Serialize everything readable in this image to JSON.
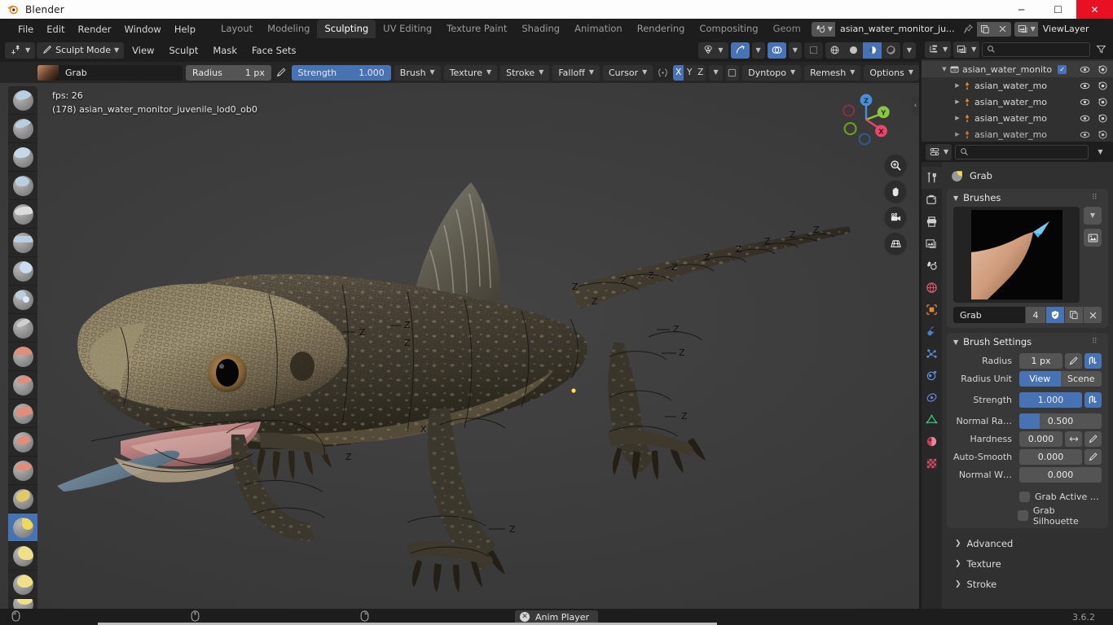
{
  "window": {
    "title": "Blender",
    "app_icon": "blender-logo-icon",
    "minimize": "─",
    "maximize": "☐",
    "close": "✕"
  },
  "topbar": {
    "menus": [
      "File",
      "Edit",
      "Render",
      "Window",
      "Help"
    ],
    "workspaces": [
      {
        "label": "Layout",
        "active": false
      },
      {
        "label": "Modeling",
        "active": false
      },
      {
        "label": "Sculpting",
        "active": true
      },
      {
        "label": "UV Editing",
        "active": false
      },
      {
        "label": "Texture Paint",
        "active": false
      },
      {
        "label": "Shading",
        "active": false
      },
      {
        "label": "Animation",
        "active": false
      },
      {
        "label": "Rendering",
        "active": false
      },
      {
        "label": "Compositing",
        "active": false
      },
      {
        "label": "Geom",
        "active": false
      }
    ],
    "scene_name": "asian_water_monitor_ju...",
    "viewlayer_name": "ViewLayer"
  },
  "viewport_header": {
    "editor_type_icon": "editor-type-icon",
    "mode": "Sculpt Mode",
    "menus": [
      "View",
      "Sculpt",
      "Mask",
      "Face Sets"
    ],
    "shading_modes": [
      "wireframe",
      "solid",
      "material-preview",
      "rendered"
    ],
    "active_shading": "material-preview"
  },
  "tool_settings": {
    "brush_name": "Grab",
    "radius_label": "Radius",
    "radius_value": "1 px",
    "strength_label": "Strength",
    "strength_value": "1.000",
    "dropdowns": [
      "Brush",
      "Texture",
      "Stroke",
      "Falloff",
      "Cursor"
    ],
    "symmetry_axes": [
      {
        "label": "X",
        "on": true
      },
      {
        "label": "Y",
        "on": false
      },
      {
        "label": "Z",
        "on": false
      }
    ],
    "dyntopo": "Dyntopo",
    "remesh": "Remesh",
    "options": "Options"
  },
  "viewport": {
    "fps_text": "fps: 26",
    "object_text": "(178) asian_water_monitor_juvenile_lod0_ob0",
    "gizmo_axes": [
      {
        "label": "Z",
        "color": "#4a8fd4"
      },
      {
        "label": "Y",
        "color": "#8ec63f"
      },
      {
        "label": "X",
        "color": "#e6476a"
      }
    ],
    "nav_buttons": [
      "zoom-icon",
      "pan-hand-icon",
      "camera-icon",
      "grid-ortho-icon"
    ],
    "background_color": "#3b3b3b"
  },
  "toolbar": {
    "tools": [
      {
        "name": "draw",
        "cap": "#b9cfe0",
        "selected": false
      },
      {
        "name": "draw-sharp",
        "cap": "#b9cfe0",
        "selected": false
      },
      {
        "name": "clay",
        "cap": "#c3d8e8",
        "selected": false
      },
      {
        "name": "clay-strips",
        "cap": "#b9cfe0",
        "selected": false
      },
      {
        "name": "clay-thumb",
        "cap": "#d8d8d8",
        "selected": false
      },
      {
        "name": "layer",
        "cap": "#b9cfe0",
        "selected": false
      },
      {
        "name": "inflate",
        "cap": "#c9dcf0",
        "selected": false
      },
      {
        "name": "blob",
        "cap": "#b9cfe0",
        "selected": false
      },
      {
        "name": "crease",
        "cap": "#cfcfcf",
        "selected": false
      },
      {
        "name": "smooth",
        "cap": "#e08e7a",
        "selected": false
      },
      {
        "name": "flatten",
        "cap": "#e08e7a",
        "selected": false
      },
      {
        "name": "fill",
        "cap": "#e08e7a",
        "selected": false
      },
      {
        "name": "scrape",
        "cap": "#e08e7a",
        "selected": false
      },
      {
        "name": "multiplane-scrape",
        "cap": "#e08e7a",
        "selected": false
      },
      {
        "name": "pinch",
        "cap": "#e0c96a",
        "selected": false
      },
      {
        "name": "grab",
        "cap": "#f0d95a",
        "selected": true
      },
      {
        "name": "elastic-deform",
        "cap": "#f0e08a",
        "selected": false
      },
      {
        "name": "snake-hook",
        "cap": "#f0e08a",
        "selected": false
      },
      {
        "name": "thumb",
        "cap": "#f0e08a",
        "selected": false
      }
    ]
  },
  "outliner": {
    "display_mode_icon": "outliner-display-mode-icon",
    "filter_icon": "filter-icon",
    "search_placeholder": "",
    "rows": [
      {
        "label": "asian_water_monito",
        "type": "collection",
        "depth": 0,
        "expanded": true,
        "checkbox": true
      },
      {
        "label": "asian_water_mo",
        "type": "object",
        "depth": 1,
        "expanded": false,
        "checkbox": false
      },
      {
        "label": "asian_water_mo",
        "type": "object",
        "depth": 1,
        "expanded": false,
        "checkbox": false
      },
      {
        "label": "asian_water_mo",
        "type": "object",
        "depth": 1,
        "expanded": false,
        "checkbox": false
      },
      {
        "label": "asian_water_mo",
        "type": "object",
        "depth": 1,
        "expanded": false,
        "checkbox": false
      }
    ]
  },
  "properties": {
    "breadcrumb_label": "Grab",
    "tabs": [
      {
        "name": "tool",
        "color": "#d6d6d6",
        "active": true
      },
      {
        "name": "render",
        "color": "#d0d0d0",
        "active": false
      },
      {
        "name": "output",
        "color": "#d0d0d0",
        "active": false
      },
      {
        "name": "view-layer",
        "color": "#d0d0d0",
        "active": false
      },
      {
        "name": "scene",
        "color": "#d9d9d9",
        "active": false
      },
      {
        "name": "world",
        "color": "#d4596b",
        "active": false
      },
      {
        "name": "object",
        "color": "#e08a3c",
        "active": false
      },
      {
        "name": "modifiers",
        "color": "#4a7fd4",
        "active": false
      },
      {
        "name": "particles",
        "color": "#5b8fd9",
        "active": false
      },
      {
        "name": "physics",
        "color": "#5b8fd9",
        "active": false
      },
      {
        "name": "constraints",
        "color": "#6a7fd4",
        "active": false
      },
      {
        "name": "data",
        "color": "#3fbf7f",
        "active": false
      },
      {
        "name": "material",
        "color": "#c4435a",
        "active": false
      },
      {
        "name": "texture",
        "color": "#c4566b",
        "active": false
      }
    ],
    "brushes_panel": {
      "title": "Brushes",
      "brush_name": "Grab",
      "users_count": "4",
      "fake_user_icon": "shield-icon",
      "duplicate_icon": "copy-icon",
      "unlink_icon": "x-icon"
    },
    "brush_settings_panel": {
      "title": "Brush Settings",
      "rows": [
        {
          "label": "Radius",
          "value": "1 px",
          "kind": "field",
          "fill": 0,
          "icons": [
            "pressure-icon",
            "unified-icon"
          ]
        },
        {
          "label": "Radius Unit",
          "kind": "segment",
          "options": [
            "View",
            "Scene"
          ],
          "selected": "View"
        },
        {
          "label": "Strength",
          "value": "1.000",
          "kind": "slider",
          "fill": 100,
          "icons": [
            "unified-icon"
          ]
        },
        {
          "label": "Normal Ra…",
          "value": "0.500",
          "kind": "slider",
          "fill": 25,
          "icons": []
        },
        {
          "label": "Hardness",
          "value": "0.000",
          "kind": "field",
          "fill": 0,
          "icons": [
            "arrows-icon",
            "pressure-icon"
          ]
        },
        {
          "label": "Auto-Smooth",
          "value": "0.000",
          "kind": "field",
          "fill": 0,
          "icons": [
            "pressure-icon"
          ]
        },
        {
          "label": "Normal W…",
          "value": "0.000",
          "kind": "field",
          "fill": 0,
          "icons": []
        }
      ],
      "checkboxes": [
        {
          "label": "Grab Active …",
          "checked": false
        },
        {
          "label": "Grab Silhouette",
          "checked": false
        }
      ],
      "subpanels": [
        "Advanced",
        "Texture",
        "Stroke"
      ]
    }
  },
  "statusbar": {
    "mouse_hints": [
      "select-mouse-icon",
      "middle-mouse-icon",
      "right-mouse-icon"
    ],
    "version": "3.6.2"
  },
  "taskbar": {
    "anim_player_label": "Anim Player",
    "anim_player_icon": "close-circle-icon"
  }
}
